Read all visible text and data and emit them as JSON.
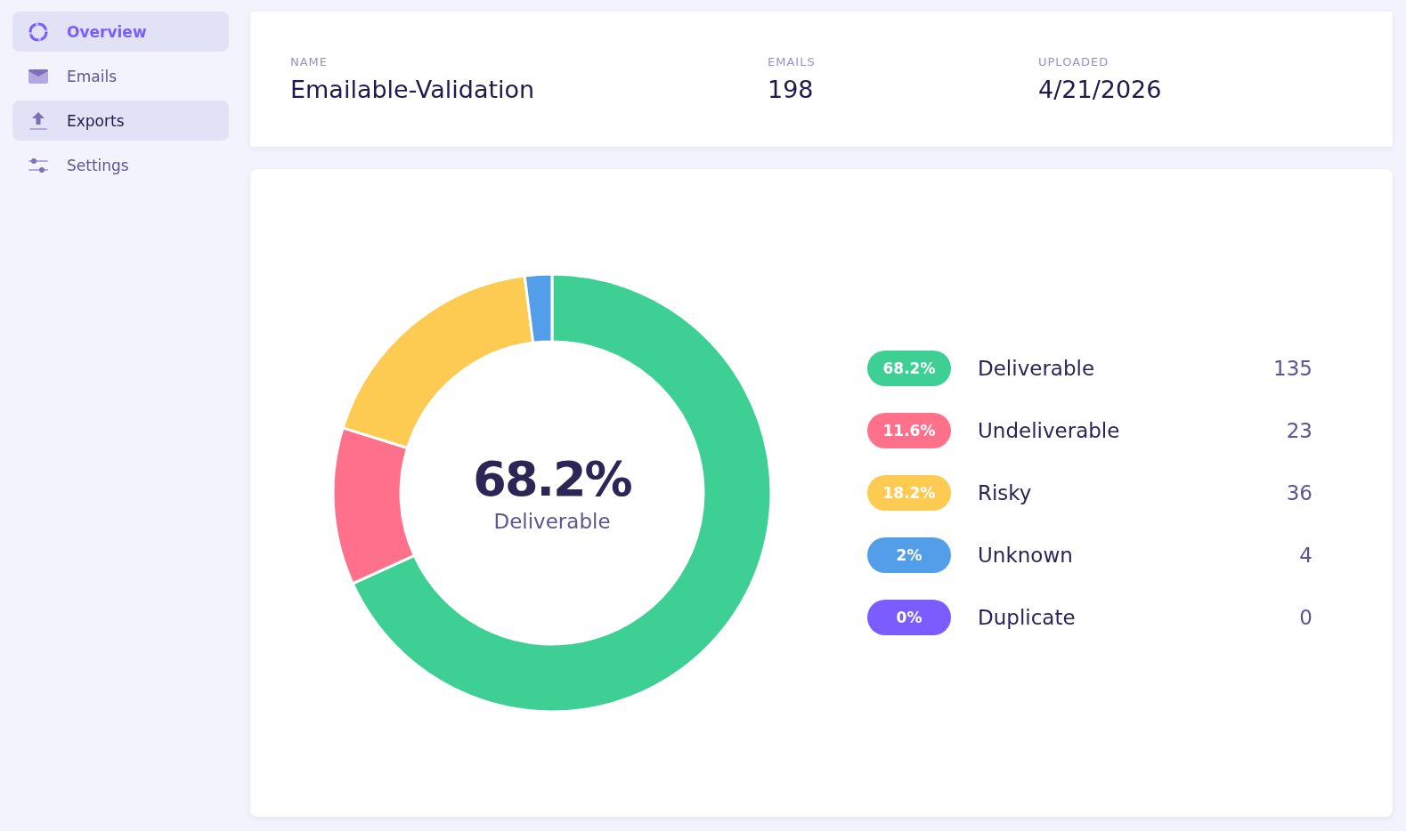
{
  "sidebar": {
    "items": [
      {
        "label": "Overview",
        "selected": true,
        "hovered": false
      },
      {
        "label": "Emails",
        "selected": false,
        "hovered": false
      },
      {
        "label": "Exports",
        "selected": false,
        "hovered": true
      },
      {
        "label": "Settings",
        "selected": false,
        "hovered": false
      }
    ]
  },
  "summary": {
    "fields": [
      {
        "label": "NAME",
        "value": "Emailable-Validation"
      },
      {
        "label": "EMAILS",
        "value": "198"
      },
      {
        "label": "UPLOADED",
        "value": "4/21/2026"
      }
    ]
  },
  "results": {
    "chart_data": {
      "type": "donut",
      "categories": [
        "Deliverable",
        "Undeliverable",
        "Risky",
        "Unknown",
        "Duplicate"
      ],
      "values": [
        68.2,
        11.6,
        18.2,
        2,
        0
      ]
    },
    "center": {
      "value": "68.2%",
      "label": "Deliverable"
    },
    "legend": [
      {
        "percent": "68.2%",
        "count": "135",
        "color": "#3ecf95"
      },
      {
        "percent": "11.6%",
        "count": "23",
        "color": "#ff718b"
      },
      {
        "percent": "18.2%",
        "count": "36",
        "color": "#fdcb52"
      },
      {
        "percent": "2%",
        "count": "4",
        "color": "#529ee8"
      },
      {
        "percent": "0%",
        "count": "0",
        "color": "#7b5cff"
      }
    ]
  }
}
